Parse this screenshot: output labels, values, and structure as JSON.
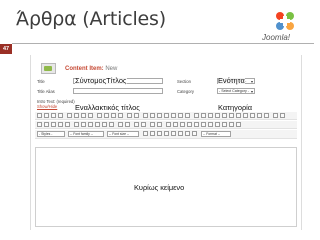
{
  "slide": {
    "title": "Άρθρα (Articles)",
    "page_number": "47",
    "logo_text": "Joomla!"
  },
  "screenshot": {
    "header_title": "Content Item:",
    "header_subtitle": "New",
    "form": {
      "title_label": "Title",
      "title_alias_label": "Title Alias",
      "section_label": "Section",
      "category_label": "Category",
      "section_value": "- Select Section -",
      "category_value": "- Select Category -",
      "intro_text_label": "Intro Text: (required)",
      "show_hide_link": "Show/Hide"
    },
    "editor_toolbar": {
      "styles_select": "- Styles -",
      "font_family_select": "-- Font family --",
      "font_size_select": "-- Font size --",
      "format_select": "-- Format --"
    }
  },
  "annotations": {
    "short_title": "ΣύντομοςΤίτλος",
    "alt_title": "Εναλλακτικός τίτλος",
    "section": "Ενότητα",
    "category": "Κατηγορία",
    "main_text": "Κυρίως κείμενο"
  },
  "colors": {
    "accent_red": "#c64934",
    "page_badge": "#9a2f25"
  },
  "icons": [
    "joomla-logo-icon",
    "content-item-icon",
    "editor-toolbar-icons"
  ]
}
